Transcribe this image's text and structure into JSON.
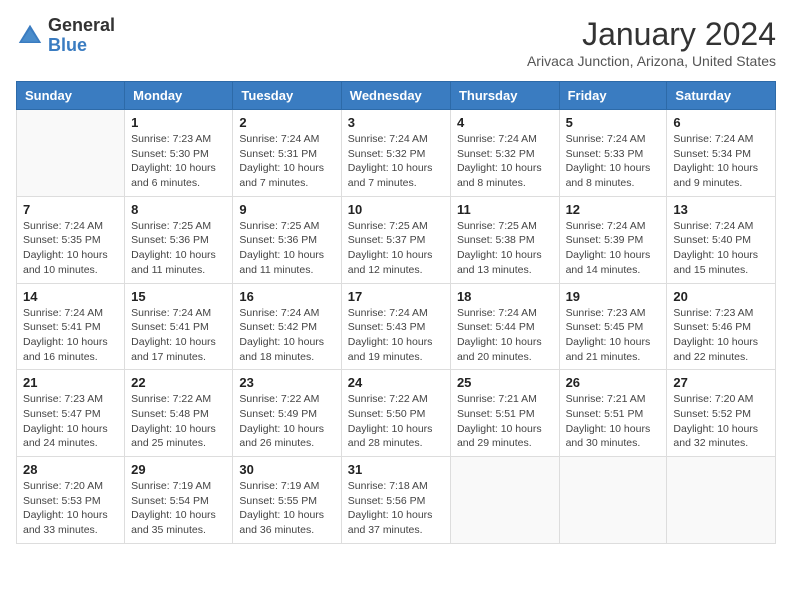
{
  "header": {
    "logo_general": "General",
    "logo_blue": "Blue",
    "month_title": "January 2024",
    "location": "Arivaca Junction, Arizona, United States"
  },
  "calendar": {
    "days_of_week": [
      "Sunday",
      "Monday",
      "Tuesday",
      "Wednesday",
      "Thursday",
      "Friday",
      "Saturday"
    ],
    "weeks": [
      [
        {
          "day": "",
          "info": ""
        },
        {
          "day": "1",
          "info": "Sunrise: 7:23 AM\nSunset: 5:30 PM\nDaylight: 10 hours\nand 6 minutes."
        },
        {
          "day": "2",
          "info": "Sunrise: 7:24 AM\nSunset: 5:31 PM\nDaylight: 10 hours\nand 7 minutes."
        },
        {
          "day": "3",
          "info": "Sunrise: 7:24 AM\nSunset: 5:32 PM\nDaylight: 10 hours\nand 7 minutes."
        },
        {
          "day": "4",
          "info": "Sunrise: 7:24 AM\nSunset: 5:32 PM\nDaylight: 10 hours\nand 8 minutes."
        },
        {
          "day": "5",
          "info": "Sunrise: 7:24 AM\nSunset: 5:33 PM\nDaylight: 10 hours\nand 8 minutes."
        },
        {
          "day": "6",
          "info": "Sunrise: 7:24 AM\nSunset: 5:34 PM\nDaylight: 10 hours\nand 9 minutes."
        }
      ],
      [
        {
          "day": "7",
          "info": "Sunrise: 7:24 AM\nSunset: 5:35 PM\nDaylight: 10 hours\nand 10 minutes."
        },
        {
          "day": "8",
          "info": "Sunrise: 7:25 AM\nSunset: 5:36 PM\nDaylight: 10 hours\nand 11 minutes."
        },
        {
          "day": "9",
          "info": "Sunrise: 7:25 AM\nSunset: 5:36 PM\nDaylight: 10 hours\nand 11 minutes."
        },
        {
          "day": "10",
          "info": "Sunrise: 7:25 AM\nSunset: 5:37 PM\nDaylight: 10 hours\nand 12 minutes."
        },
        {
          "day": "11",
          "info": "Sunrise: 7:25 AM\nSunset: 5:38 PM\nDaylight: 10 hours\nand 13 minutes."
        },
        {
          "day": "12",
          "info": "Sunrise: 7:24 AM\nSunset: 5:39 PM\nDaylight: 10 hours\nand 14 minutes."
        },
        {
          "day": "13",
          "info": "Sunrise: 7:24 AM\nSunset: 5:40 PM\nDaylight: 10 hours\nand 15 minutes."
        }
      ],
      [
        {
          "day": "14",
          "info": "Sunrise: 7:24 AM\nSunset: 5:41 PM\nDaylight: 10 hours\nand 16 minutes."
        },
        {
          "day": "15",
          "info": "Sunrise: 7:24 AM\nSunset: 5:41 PM\nDaylight: 10 hours\nand 17 minutes."
        },
        {
          "day": "16",
          "info": "Sunrise: 7:24 AM\nSunset: 5:42 PM\nDaylight: 10 hours\nand 18 minutes."
        },
        {
          "day": "17",
          "info": "Sunrise: 7:24 AM\nSunset: 5:43 PM\nDaylight: 10 hours\nand 19 minutes."
        },
        {
          "day": "18",
          "info": "Sunrise: 7:24 AM\nSunset: 5:44 PM\nDaylight: 10 hours\nand 20 minutes."
        },
        {
          "day": "19",
          "info": "Sunrise: 7:23 AM\nSunset: 5:45 PM\nDaylight: 10 hours\nand 21 minutes."
        },
        {
          "day": "20",
          "info": "Sunrise: 7:23 AM\nSunset: 5:46 PM\nDaylight: 10 hours\nand 22 minutes."
        }
      ],
      [
        {
          "day": "21",
          "info": "Sunrise: 7:23 AM\nSunset: 5:47 PM\nDaylight: 10 hours\nand 24 minutes."
        },
        {
          "day": "22",
          "info": "Sunrise: 7:22 AM\nSunset: 5:48 PM\nDaylight: 10 hours\nand 25 minutes."
        },
        {
          "day": "23",
          "info": "Sunrise: 7:22 AM\nSunset: 5:49 PM\nDaylight: 10 hours\nand 26 minutes."
        },
        {
          "day": "24",
          "info": "Sunrise: 7:22 AM\nSunset: 5:50 PM\nDaylight: 10 hours\nand 28 minutes."
        },
        {
          "day": "25",
          "info": "Sunrise: 7:21 AM\nSunset: 5:51 PM\nDaylight: 10 hours\nand 29 minutes."
        },
        {
          "day": "26",
          "info": "Sunrise: 7:21 AM\nSunset: 5:51 PM\nDaylight: 10 hours\nand 30 minutes."
        },
        {
          "day": "27",
          "info": "Sunrise: 7:20 AM\nSunset: 5:52 PM\nDaylight: 10 hours\nand 32 minutes."
        }
      ],
      [
        {
          "day": "28",
          "info": "Sunrise: 7:20 AM\nSunset: 5:53 PM\nDaylight: 10 hours\nand 33 minutes."
        },
        {
          "day": "29",
          "info": "Sunrise: 7:19 AM\nSunset: 5:54 PM\nDaylight: 10 hours\nand 35 minutes."
        },
        {
          "day": "30",
          "info": "Sunrise: 7:19 AM\nSunset: 5:55 PM\nDaylight: 10 hours\nand 36 minutes."
        },
        {
          "day": "31",
          "info": "Sunrise: 7:18 AM\nSunset: 5:56 PM\nDaylight: 10 hours\nand 37 minutes."
        },
        {
          "day": "",
          "info": ""
        },
        {
          "day": "",
          "info": ""
        },
        {
          "day": "",
          "info": ""
        }
      ]
    ]
  }
}
